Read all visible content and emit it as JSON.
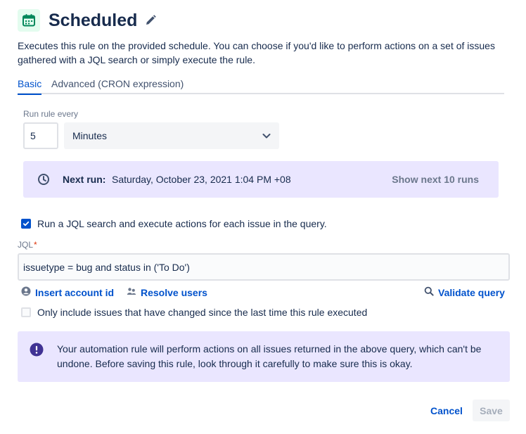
{
  "header": {
    "title": "Scheduled",
    "icon": "calendar-icon",
    "edit_icon": "pencil-icon"
  },
  "description": "Executes this rule on the provided schedule. You can choose if you'd like to perform actions on a set of issues gathered with a JQL search or simply execute the rule.",
  "tabs": [
    {
      "label": "Basic",
      "active": true
    },
    {
      "label": "Advanced (CRON expression)",
      "active": false
    }
  ],
  "schedule": {
    "label": "Run rule every",
    "interval_value": "5",
    "unit": "Minutes"
  },
  "next_run": {
    "label": "Next run:",
    "value": "Saturday, October 23, 2021 1:04 PM +08",
    "show_more": "Show next 10 runs"
  },
  "jql_checkbox": {
    "label": "Run a JQL search and execute actions for each issue in the query.",
    "checked": true
  },
  "jql": {
    "label": "JQL",
    "required_marker": "*",
    "value": "issuetype = bug and status in ('To Do')"
  },
  "links": {
    "insert_account": "Insert account id",
    "resolve_users": "Resolve users",
    "validate": "Validate query"
  },
  "changed_checkbox": {
    "label": "Only include issues that have changed since the last time this rule executed",
    "checked": false
  },
  "warning": {
    "text": "Your automation rule will perform actions on all issues returned in the above query, which can't be undone. Before saving this rule, look through it carefully to make sure this is okay."
  },
  "actions": {
    "cancel": "Cancel",
    "save": "Save"
  },
  "colors": {
    "primary": "#0052cc",
    "info_bg": "#eae6ff",
    "icon_green": "#00875a",
    "warn_icon": "#403294"
  }
}
